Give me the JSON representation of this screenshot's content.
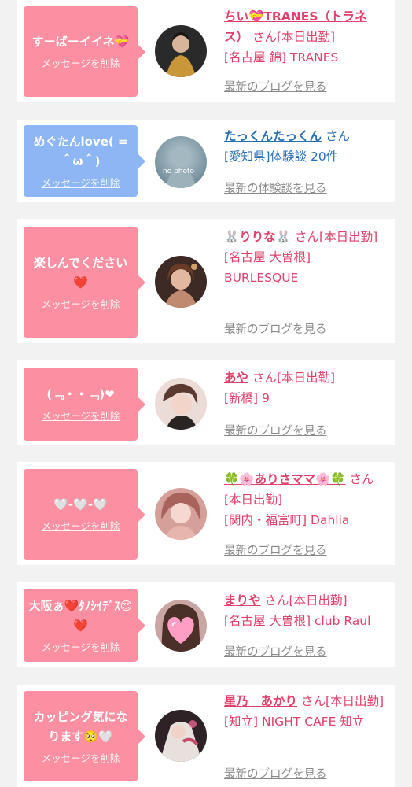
{
  "cards": [
    {
      "message": "すーばーイイネ💝",
      "delete_label": "メッセージを削除",
      "name": "ちい💝TRANES（トラネス）",
      "suffix": "さん[本日出勤]",
      "shop": "[名古屋 錦] TRANES",
      "link": "最新のブログを見る",
      "avatar_color": "#2a2a2a"
    },
    {
      "message": "めぐたんlove( = ＾ω＾)",
      "delete_label": "メッセージを削除",
      "name": "たっくんたっくん",
      "suffix": "さん",
      "shop": "[愛知県]体験談 20件",
      "link": "最新の体験談を見る",
      "avatar_label": "no photo",
      "avatar_color": "#8aa4b0"
    },
    {
      "message": "楽しんでください❤️",
      "delete_label": "メッセージを削除",
      "name": "🐰りりな🐰",
      "suffix": "さん[本日出勤]",
      "shop": "[名古屋 大曽根] BURLESQUE",
      "link": "最新のブログを見る",
      "avatar_color": "#5a3a2e"
    },
    {
      "message": "(﹃・・﹃)❤",
      "delete_label": "メッセージを削除",
      "name": "あや",
      "suffix": "さん[本日出勤]",
      "shop": "[新橋] 9",
      "link": "最新のブログを見る",
      "avatar_color": "#e8d3cf"
    },
    {
      "message": "🤍-🤍-🤍",
      "delete_label": "メッセージを削除",
      "name": "🍀🌸ありさママ🌸🍀",
      "suffix": "さん[本日出勤]",
      "shop": "[関内・福富町] Dahlia",
      "link": "最新のブログを見る",
      "avatar_color": "#c98a8a"
    },
    {
      "message": "大阪ぁ❤️ﾀﾉｼｲﾃﾞｽ😍❤️",
      "delete_label": "メッセージを削除",
      "name": "まりや",
      "suffix": "さん[本日出勤]",
      "shop": "[名古屋 大曽根] club Raul",
      "link": "最新のブログを見る",
      "avatar_color": "#f08fb0"
    },
    {
      "message": "カッピング気になります🥺🤍",
      "delete_label": "メッセージを削除",
      "name": "星乃　あかり",
      "suffix": "さん[本日出勤]",
      "shop": "[知立] NIGHT CAFE 知立",
      "link": "最新のブログを見る",
      "avatar_color": "#3a2a2e"
    }
  ],
  "colors": {
    "pink_bubble": "#fc8fa1",
    "blue_bubble": "#8fb6f4",
    "name_pink": "#e0406a",
    "name_blue": "#2a6fb5",
    "link_gray": "#8a8a8a"
  }
}
